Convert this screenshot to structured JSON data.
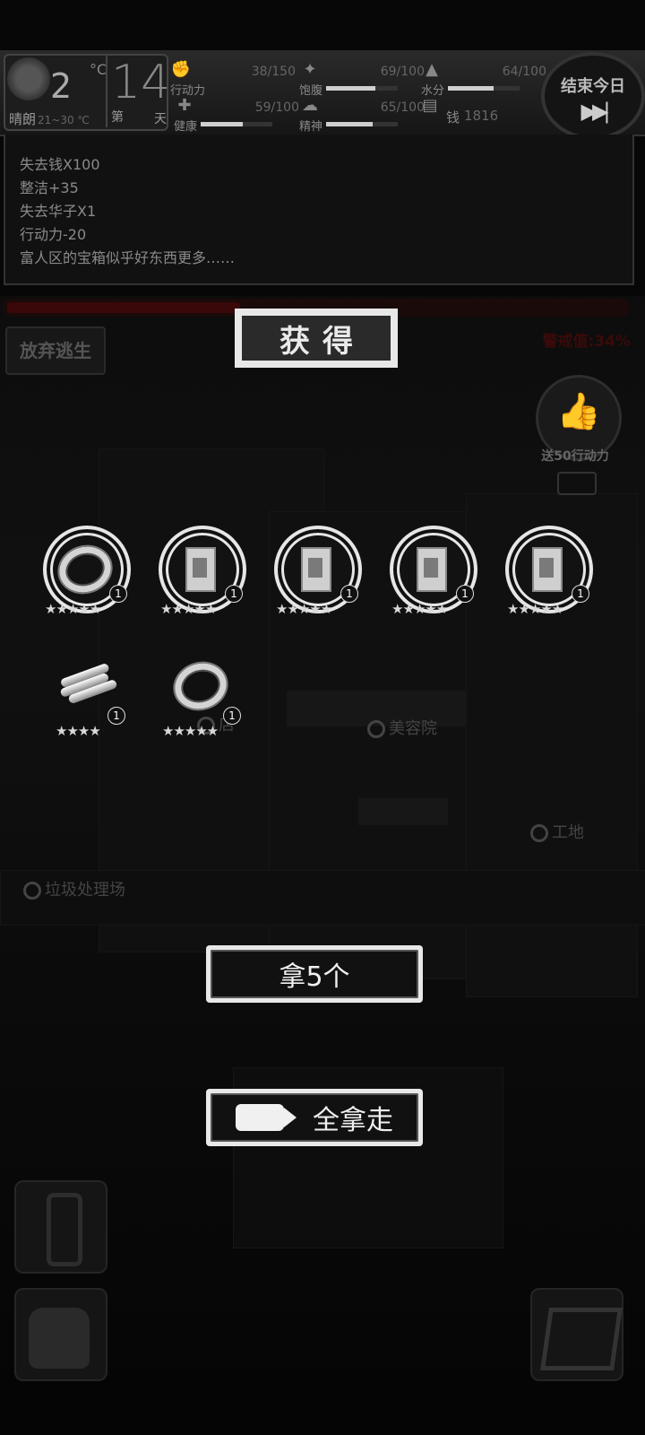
{
  "hud": {
    "weather": {
      "temp": "2",
      "unit": "°C",
      "desc": "晴朗",
      "range": "21~30 ℃"
    },
    "day": {
      "number": "14",
      "prefix": "第",
      "suffix": "天"
    },
    "stats": [
      {
        "label": "行动力",
        "value": "38/150",
        "fill": 0.25,
        "icon": "lightning-icon"
      },
      {
        "label": "饱腹",
        "value": "69/100",
        "fill": 0.69,
        "icon": "food-icon"
      },
      {
        "label": "水分",
        "value": "64/100",
        "fill": 0.64,
        "icon": "water-icon"
      },
      {
        "label": "健康",
        "value": "59/100",
        "fill": 0.59,
        "icon": "health-icon"
      },
      {
        "label": "精神",
        "value": "65/100",
        "fill": 0.65,
        "icon": "spirit-icon"
      },
      {
        "label": "钱",
        "value": "1816",
        "icon": "money-icon"
      }
    ],
    "end_day_label": "结束今日"
  },
  "log": {
    "lines": [
      "失去钱X100",
      "整洁+35",
      "失去华子X1",
      "行动力-20",
      "富人区的宝箱似乎好东西更多……"
    ]
  },
  "scene": {
    "abandon_label": "放弃逃生",
    "danger_label": "警戒值:34%",
    "thumb_label": "送50行动力",
    "locations": [
      "店",
      "美容院",
      "工地",
      "垃圾处理场"
    ]
  },
  "dialog": {
    "title": "获得",
    "items": [
      {
        "name": "bracelet",
        "count": "1",
        "stars": "★★★★★"
      },
      {
        "name": "cigarette-box",
        "count": "1",
        "stars": "★★★★★"
      },
      {
        "name": "cigarette-box",
        "count": "1",
        "stars": "★★★★★"
      },
      {
        "name": "cigarette-box",
        "count": "1",
        "stars": "★★★★★"
      },
      {
        "name": "cigarette-box",
        "count": "1",
        "stars": "★★★★★"
      },
      {
        "name": "steel-pipes",
        "count": "1",
        "stars": "★★★★"
      },
      {
        "name": "bracelet",
        "count": "1",
        "stars": "★★★★★"
      }
    ],
    "take_button": "拿5个",
    "take_all_button": "全拿走"
  }
}
